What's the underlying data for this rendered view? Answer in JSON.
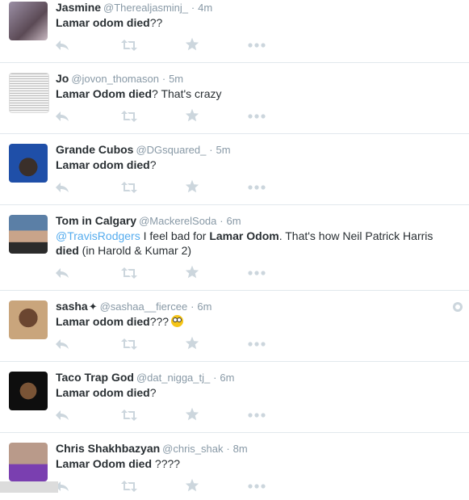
{
  "tweets": [
    {
      "name": "Jasmine",
      "handle": "@Therealjasminj_",
      "time": "4m",
      "parts": [
        {
          "t": "Lamar odom died",
          "b": true
        },
        {
          "t": "??",
          "b": false
        }
      ]
    },
    {
      "name": "Jo",
      "handle": "@jovon_thomason",
      "time": "5m",
      "parts": [
        {
          "t": "Lamar Odom died",
          "b": true
        },
        {
          "t": "? That's crazy",
          "b": false
        }
      ]
    },
    {
      "name": "Grande Cubos",
      "handle": "@DGsquared_",
      "time": "5m",
      "parts": [
        {
          "t": "Lamar odom died",
          "b": true
        },
        {
          "t": "?",
          "b": false
        }
      ]
    },
    {
      "name": "Tom in Calgary",
      "handle": "@MackerelSoda",
      "time": "6m",
      "parts": [
        {
          "t": "@TravisRodgers",
          "m": true
        },
        {
          "t": " I feel bad for ",
          "b": false
        },
        {
          "t": "Lamar Odom",
          "b": true
        },
        {
          "t": ". That's how Neil Patrick Harris ",
          "b": false
        },
        {
          "t": "died",
          "b": true
        },
        {
          "t": " (in Harold & Kumar 2)",
          "b": false
        }
      ]
    },
    {
      "name": "sasha",
      "handle": "@sashaa__fiercee",
      "time": "6m",
      "parts": [
        {
          "t": "Lamar odom died",
          "b": true
        },
        {
          "t": "???",
          "b": false
        }
      ]
    },
    {
      "name": "Taco Trap God",
      "handle": "@dat_nigga_tj_",
      "time": "6m",
      "parts": [
        {
          "t": "Lamar odom died",
          "b": true
        },
        {
          "t": "?",
          "b": false
        }
      ]
    },
    {
      "name": "Chris Shakhbazyan",
      "handle": "@chris_shak",
      "time": "8m",
      "parts": [
        {
          "t": "Lamar Odom died",
          "b": true
        },
        {
          "t": " ????",
          "b": false
        }
      ]
    }
  ],
  "separator": "·",
  "sparkle_glyph": "✦",
  "colors": {
    "link": "#55acee",
    "action_icon": "#ccd6dd",
    "meta": "#8899a6"
  },
  "icons": [
    "reply-icon",
    "retweet-icon",
    "favorite-icon",
    "more-icon"
  ]
}
